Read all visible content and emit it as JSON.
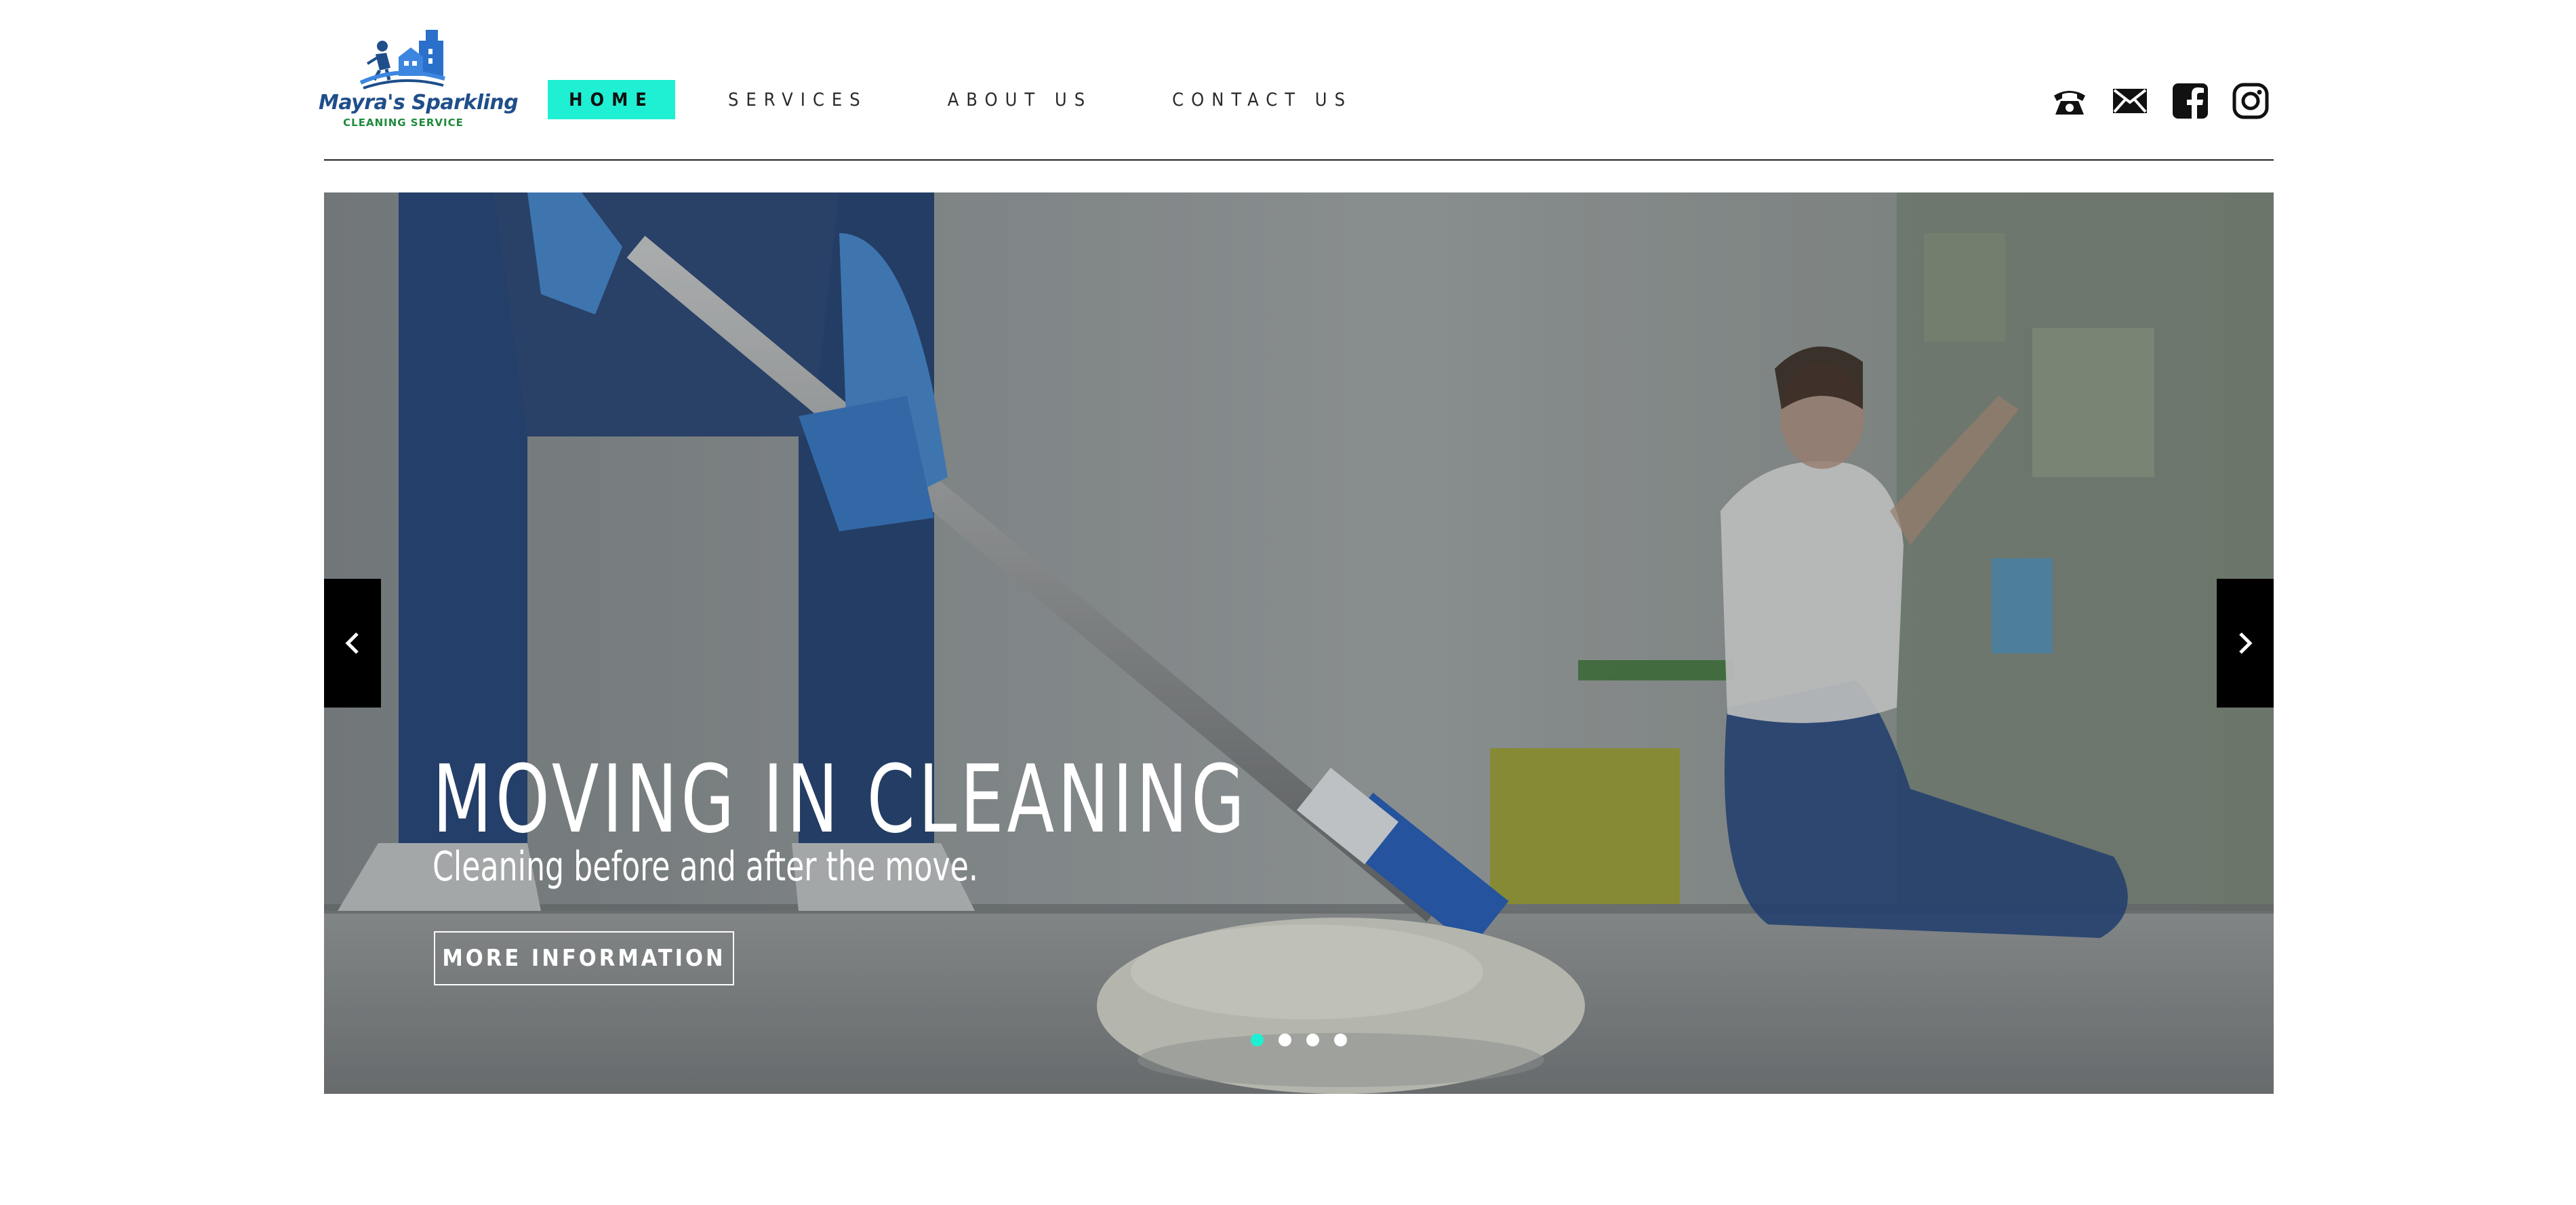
{
  "brand": {
    "name": "Mayra's Sparkling",
    "tagline": "CLEANING SERVICE"
  },
  "nav": {
    "items": [
      {
        "label": "HOME",
        "active": true
      },
      {
        "label": "SERVICES",
        "active": false
      },
      {
        "label": "ABOUT US",
        "active": false
      },
      {
        "label": "CONTACT US",
        "active": false
      }
    ]
  },
  "social": {
    "icons": [
      "phone-icon",
      "mail-icon",
      "facebook-icon",
      "instagram-icon"
    ]
  },
  "hero": {
    "title": "MOVING IN CLEANING",
    "subtitle": "Cleaning before and after the move.",
    "button_label": "MORE INFORMATION",
    "slide_count": 4,
    "active_slide": 1,
    "prev_icon": "chevron-left-icon",
    "next_icon": "chevron-right-icon"
  },
  "colors": {
    "accent": "#1ff0d4",
    "brand_blue": "#1f4e8a",
    "brand_green": "#1e8a3c",
    "text_dark": "#2a2a2a"
  }
}
